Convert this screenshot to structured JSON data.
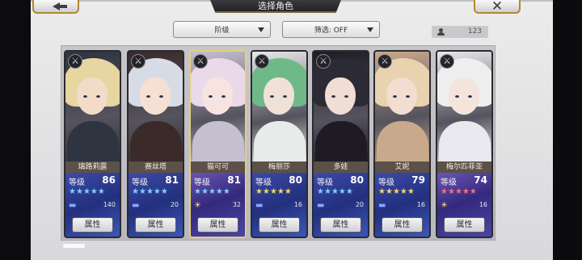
{
  "window": {
    "title": "选择角色"
  },
  "toolbar": {
    "sort_label": "阶级",
    "filter_label": "筛选: OFF",
    "count": "123"
  },
  "characters": [
    {
      "name": "璃路莉露",
      "level_label": "等级",
      "level": "86",
      "stars": 5,
      "star_color": "#7fd0ff",
      "bond": "140",
      "attr_label": "属性",
      "element": "blue",
      "hair": "#e8d6a2",
      "skin": "#f2dcc9",
      "outfit": "#2e3440"
    },
    {
      "name": "赛丝塔",
      "level_label": "等级",
      "level": "81",
      "stars": 5,
      "star_color": "#7fd0ff",
      "bond": "20",
      "attr_label": "属性",
      "element": "blue",
      "hair": "#d7dbe6",
      "skin": "#f6e0d4",
      "outfit": "#3a2a2a"
    },
    {
      "name": "猫可可",
      "level_label": "等级",
      "level": "81",
      "stars": 5,
      "star_color": "#7fd0ff",
      "bond": "32",
      "attr_label": "属性",
      "element": "gold",
      "hair": "#e9d9e9",
      "skin": "#f7e4e0",
      "outfit": "#c5c0d0",
      "selected": true
    },
    {
      "name": "梅丽莎",
      "level_label": "等级",
      "level": "80",
      "stars": 5,
      "star_color": "#f3d664",
      "bond": "16",
      "attr_label": "属性",
      "element": "blue",
      "hair": "#6fb989",
      "skin": "#efe1d8",
      "outfit": "#e9eaea"
    },
    {
      "name": "多娃",
      "level_label": "等级",
      "level": "80",
      "stars": 5,
      "star_color": "#7fd0ff",
      "bond": "20",
      "attr_label": "属性",
      "element": "blue",
      "hair": "#2c2a35",
      "skin": "#f0ddd4",
      "outfit": "#1e1b24"
    },
    {
      "name": "艾妮",
      "level_label": "等级",
      "level": "79",
      "stars": 5,
      "star_color": "#f3d664",
      "bond": "16",
      "attr_label": "属性",
      "element": "blue",
      "hair": "#e8d2b0",
      "skin": "#f2ddd0",
      "outfit": "#c9a98c"
    },
    {
      "name": "梅尔匹菲亚",
      "level_label": "等级",
      "level": "74",
      "stars": 5,
      "star_color": "#ff6e7a",
      "bond": "16",
      "attr_label": "属性",
      "element": "gold",
      "hair": "#eeeeee",
      "skin": "#f4e4dc",
      "outfit": "#e8e8ee"
    }
  ],
  "icons": {
    "back": "arrow-left-icon",
    "close": "close-icon",
    "type": "crossed-swords-icon",
    "user": "user-icon"
  }
}
